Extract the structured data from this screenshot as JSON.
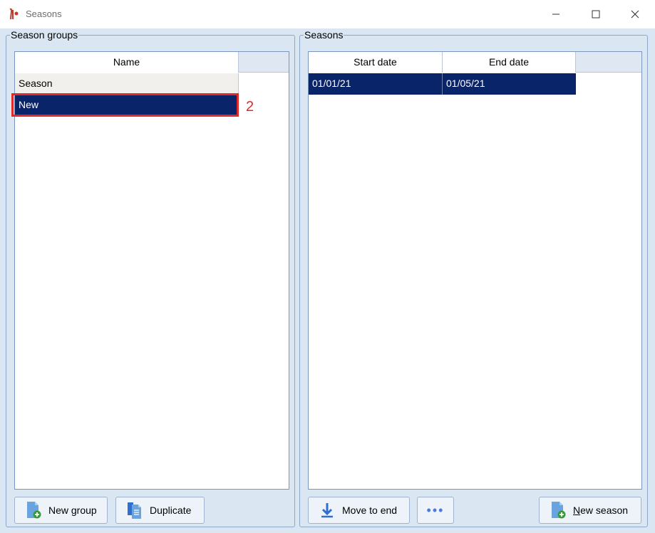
{
  "window": {
    "title": "Seasons",
    "icons": {
      "app": "app-logo-icon",
      "minimize": "minimize-icon",
      "maximize": "maximize-icon",
      "close": "close-icon"
    }
  },
  "season_groups": {
    "legend": "Season groups",
    "columns": [
      "Name"
    ],
    "rows": [
      {
        "name": "Season",
        "selected": false
      },
      {
        "name": "New",
        "selected": true
      }
    ],
    "buttons": {
      "new_group": {
        "label": "New group",
        "icon": "new-document-plus-icon"
      },
      "duplicate": {
        "label": "Duplicate",
        "icon": "duplicate-documents-icon"
      }
    }
  },
  "seasons": {
    "legend": "Seasons",
    "columns": [
      "Start date",
      "End date"
    ],
    "rows": [
      {
        "start": "01/01/21",
        "end": "01/05/21",
        "selected": true
      }
    ],
    "buttons": {
      "move_to_end": {
        "label": "Move to end",
        "icon": "arrow-down-to-line-icon"
      },
      "more": {
        "label": "•••",
        "icon": "more-dots-icon"
      },
      "new_season": {
        "label_mnemonic": "N",
        "label_rest": "ew season",
        "icon": "new-document-plus-icon"
      }
    }
  },
  "annotation": {
    "label": "2",
    "color": "#e02a2a"
  },
  "colors": {
    "selection": "#0a246a",
    "client_background": "#dbe6f3",
    "accent": "#2f6fd0"
  }
}
